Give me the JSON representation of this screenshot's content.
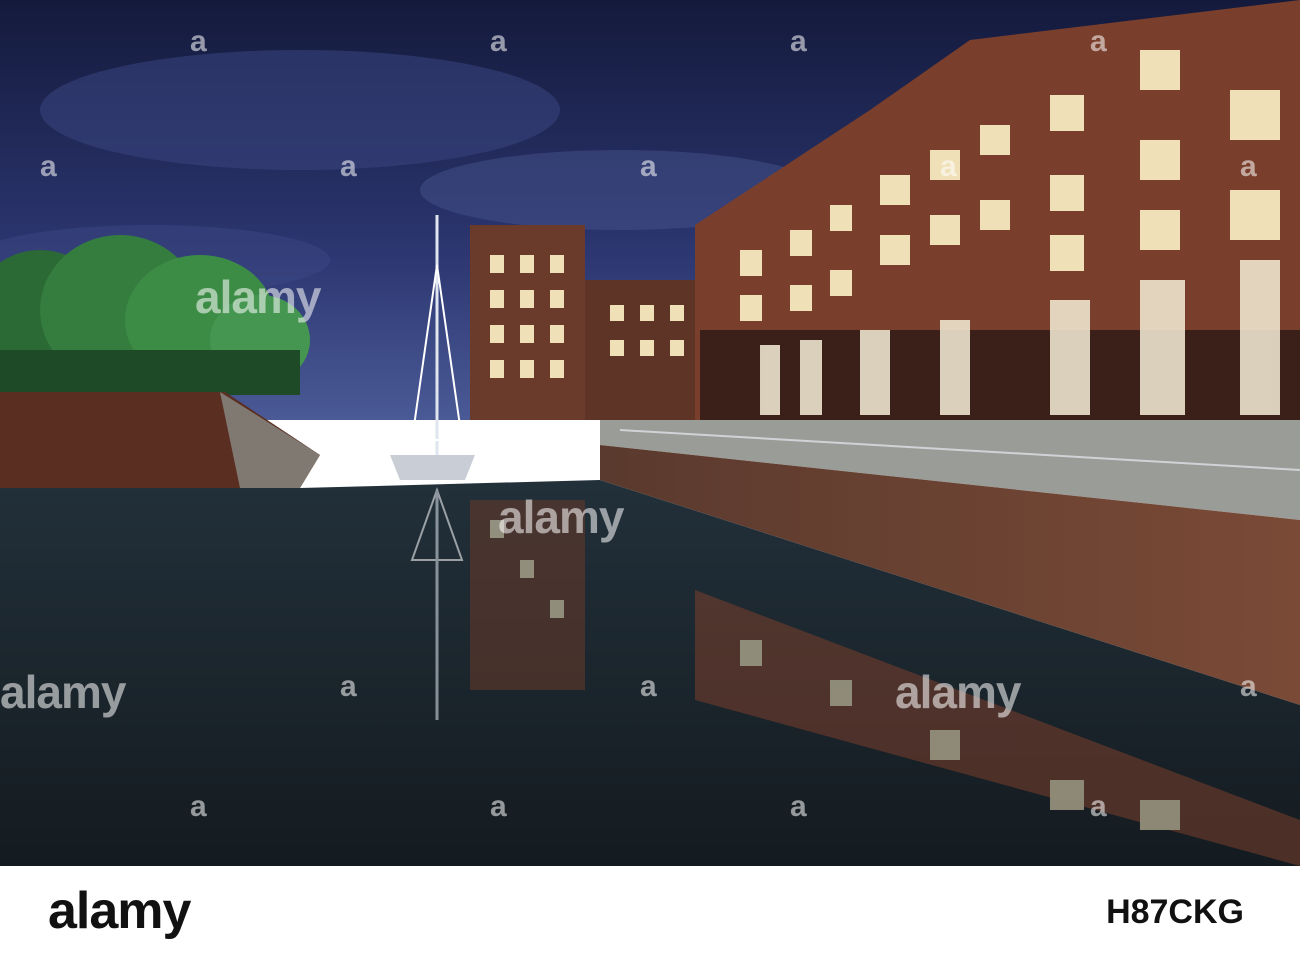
{
  "photo": {
    "subject": "marina-at-night",
    "colors": {
      "sky_top": "#1c2350",
      "sky_bottom": "#3b4a8a",
      "water": "#1a2329",
      "brick": "#7a3f2c",
      "window_light": "#f4e7c4",
      "tree": "#2f7a3a"
    }
  },
  "watermark": {
    "brand_text": "alamy",
    "mark_glyph": "a"
  },
  "footer": {
    "brand": "alamy",
    "image_id": "H87CKG"
  }
}
